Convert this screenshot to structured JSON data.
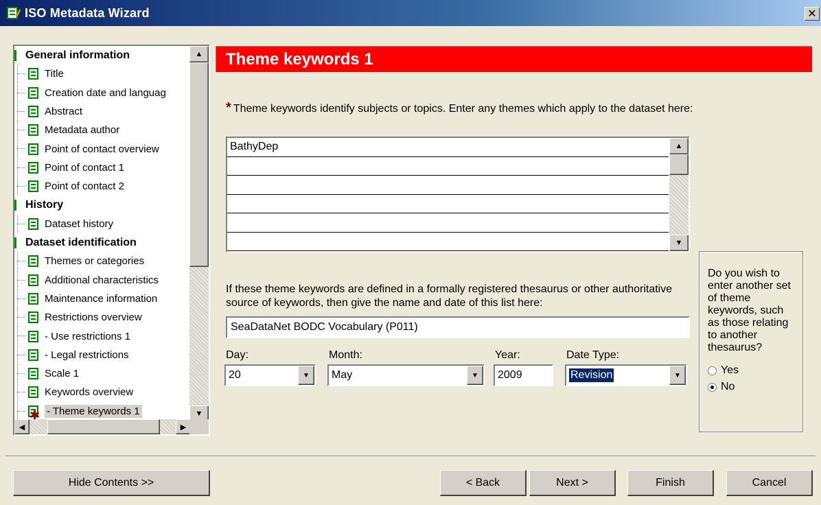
{
  "window": {
    "title": "ISO Metadata Wizard",
    "close_glyph": "✕"
  },
  "tree": {
    "rows": [
      {
        "kind": "heading",
        "label": "General information"
      },
      {
        "kind": "item",
        "label": "Title"
      },
      {
        "kind": "item",
        "label": "Creation date and languag"
      },
      {
        "kind": "item",
        "label": "Abstract"
      },
      {
        "kind": "item",
        "label": "Metadata author"
      },
      {
        "kind": "item",
        "label": "Point of contact overview"
      },
      {
        "kind": "item",
        "label": "Point of contact 1"
      },
      {
        "kind": "item",
        "label": "Point of contact 2"
      },
      {
        "kind": "heading",
        "label": "History"
      },
      {
        "kind": "item",
        "label": "Dataset history"
      },
      {
        "kind": "heading",
        "label": "Dataset identification"
      },
      {
        "kind": "item",
        "label": "Themes or categories"
      },
      {
        "kind": "item",
        "label": "Additional characteristics"
      },
      {
        "kind": "item",
        "label": "Maintenance information"
      },
      {
        "kind": "item",
        "label": "Restrictions overview"
      },
      {
        "kind": "item",
        "label": "- Use restrictions 1"
      },
      {
        "kind": "item",
        "label": "- Legal restrictions"
      },
      {
        "kind": "item",
        "label": "Scale 1"
      },
      {
        "kind": "item",
        "label": "Keywords overview"
      },
      {
        "kind": "item",
        "label": "- Theme keywords 1",
        "selected": true
      }
    ]
  },
  "page": {
    "header": "Theme keywords 1",
    "instruction": "Theme keywords identify subjects or topics.  Enter any themes which apply to the dataset here:",
    "keywords": [
      "BathyDep",
      "",
      "",
      "",
      "",
      ""
    ],
    "thesaurus_label": "If these theme keywords are defined in a formally registered thesaurus or other authoritative source of keywords, then give the name and date of this list here:",
    "thesaurus_value": "SeaDataNet BODC Vocabulary (P011)",
    "day_label": "Day:",
    "day_value": "20",
    "month_label": "Month:",
    "month_value": "May",
    "year_label": "Year:",
    "year_value": "2009",
    "datetype_label": "Date Type:",
    "datetype_value": "Revision"
  },
  "side": {
    "question": "Do you wish to enter another set of theme keywords, such as those relating to another thesaurus?",
    "yes": "Yes",
    "no": "No",
    "selected": "No"
  },
  "buttons": {
    "hide_contents": "Hide Contents >>",
    "back": "< Back",
    "next": "Next >",
    "finish": "Finish",
    "cancel": "Cancel"
  },
  "colors": {
    "header_bg": "#ff0000",
    "required_star": "#8b0000",
    "icon_green": "#008000"
  }
}
